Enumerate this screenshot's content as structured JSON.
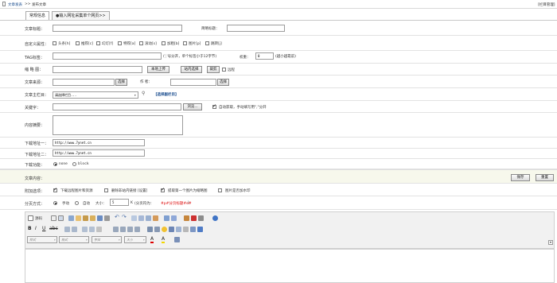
{
  "breadcrumb": {
    "part1": "文章发表",
    "sep": ">>",
    "part2": "发布文章"
  },
  "top_right_link": "[栏目管理]",
  "tabs": {
    "basic": "常规信息",
    "collect": "●输入网址采集单个网页>>"
  },
  "title_label": "文章标题：",
  "short_title_label": "简略标题：",
  "attr_label": "自定义属性：",
  "attrs": [
    "头条[h]",
    "推荐[c]",
    "幻灯[f]",
    "特荐[a]",
    "滚动[s]",
    "加粗[b]",
    "图片[p]",
    "跳转[j]"
  ],
  "tag_label": "TAG标签：",
  "tag_hint": "(','号分开，单个标签小于12字节)",
  "weight_label": "权重：",
  "weight_value": "0",
  "weight_hint": "(越小越靠前)",
  "thumb_label": "缩 略 图：",
  "thumb_local_btn": "本地上传",
  "thumb_site_btn": "站内选择",
  "thumb_crop_btn": "裁剪",
  "thumb_remote": "远程",
  "source_label": "文章来源：",
  "source_btn": "选择",
  "author_label": "作  者：",
  "author_btn": "选择",
  "column_label": "文章主栏目：",
  "column_select": "请选择栏目...",
  "sub_column_link": "【选择副栏目】",
  "keywords_label": "关键字：",
  "browse_btn": "浏览...",
  "auto_kw": "自动获取，手动填写用\",\"分开",
  "summary_label": "内容摘要：",
  "dl1_label": "下载地址一：",
  "dl1_value": "http://www.7ynet.cn",
  "dl2_label": "下载地址二：",
  "dl2_value": "http://www.7ynet.cn",
  "dl_func_label": "下载功能：",
  "dl_func_none": "none",
  "dl_func_block": "block",
  "content_label": "文章内容：",
  "save_btn": "保存",
  "reset_btn": "重置",
  "extra_label": "附加选项：",
  "extra_opts": [
    "下载远程图片和资源",
    "删除非站内链接 [设置]",
    "提取第一个图片为缩略图",
    "图片是否加水印"
  ],
  "page_label": "分页方式：",
  "page_manual": "手动",
  "page_auto": "自动",
  "page_size_label": "大小：",
  "page_size_value": "5",
  "page_size_unit": "K",
  "page_tag_hint": "(分页符为：",
  "page_tag_value": "#p#分页标题#e#",
  "page_tag_end": ")",
  "editor": {
    "source_btn": "源码",
    "style_select": "样式",
    "format_select": "格式",
    "font_select": "字体",
    "size_select": "大小"
  },
  "colors": {
    "accent_red": "#dd0000",
    "section_bg": "#f7f8ec",
    "border": "#9c9c9c"
  }
}
